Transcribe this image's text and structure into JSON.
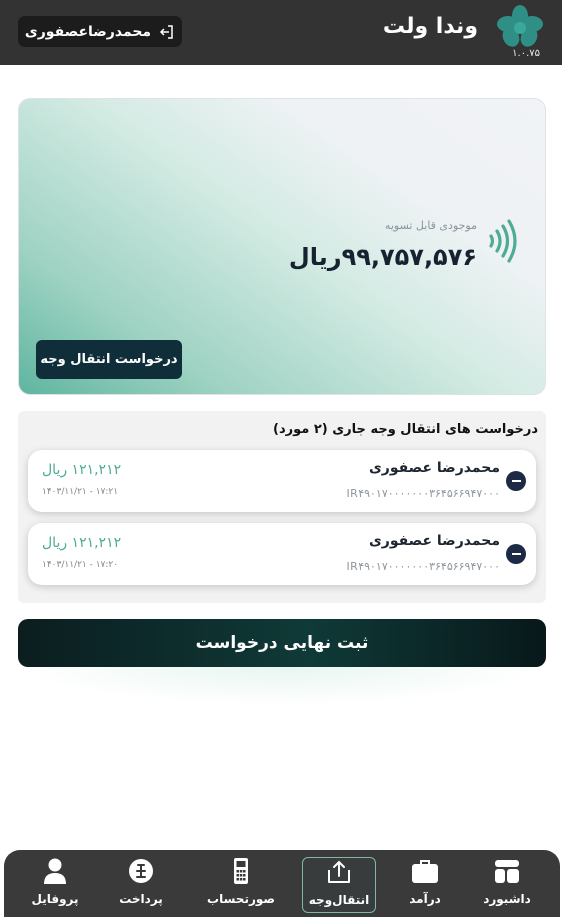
{
  "header": {
    "brand": "وندا ولت",
    "version": "۱.۰.۷۵",
    "user_name": "محمدرضاعصفوری",
    "logout_icon": "logout-icon",
    "logo_icon": "flower-logo-icon"
  },
  "balance_card": {
    "label": "موجودی قابل تسویه",
    "value": "۹۹,۷۵۷,۵۷۶ریال",
    "nfc_icon": "contactless-icon",
    "transfer_button": "درخواست انتقال وجه"
  },
  "requests": {
    "title": "درخواست های انتقال وجه جاری (۲ مورد)",
    "items": [
      {
        "name": "محمدرضا عصفوری",
        "iban": "IR۴۹۰۱۷۰۰۰۰۰۰۰۳۶۴۵۶۶۹۴۷۰۰۰",
        "amount": "۱۲۱,۲۱۲ ریال",
        "datetime": "۱۴۰۳/۱۱/۲۱ - ۱۷:۲۱"
      },
      {
        "name": "محمدرضا عصفوری",
        "iban": "IR۴۹۰۱۷۰۰۰۰۰۰۰۳۶۴۵۶۶۹۴۷۰۰۰",
        "amount": "۱۲۱,۲۱۲ ریال",
        "datetime": "۱۴۰۳/۱۱/۲۱ - ۱۷:۲۰"
      }
    ]
  },
  "submit_button": "ثبت نهایی درخواست",
  "nav": {
    "items": [
      {
        "label": "داشبورد",
        "icon": "dashboard-icon"
      },
      {
        "label": "درآمد",
        "icon": "briefcase-icon"
      },
      {
        "label": "انتقال‌وجه",
        "icon": "transfer-icon"
      },
      {
        "label": "صورتحساب",
        "icon": "pos-icon"
      },
      {
        "label": "پرداخت",
        "icon": "payment-icon"
      },
      {
        "label": "پروفایل",
        "icon": "user-icon"
      }
    ],
    "active": "انتقال‌وجه"
  },
  "colors": {
    "header_bg": "#333333",
    "accent_teal": "#4eab96",
    "dark_navy": "#0f2e3a",
    "nav_bg": "#3a3a3a"
  }
}
